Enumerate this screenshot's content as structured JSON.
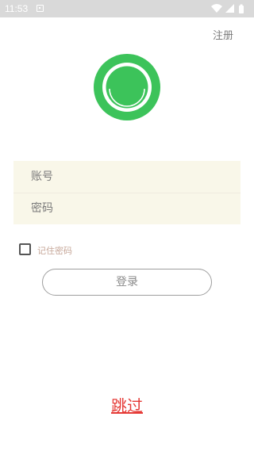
{
  "status_bar": {
    "time": "11:53",
    "icons": [
      "notification-icon",
      "wifi-icon",
      "cell-signal-icon",
      "battery-icon"
    ],
    "background": "#d9d9d9"
  },
  "header": {
    "register_label": "注册"
  },
  "logo": {
    "icon": "app-logo-ring",
    "color": "#3cc35a"
  },
  "form": {
    "account_placeholder": "账号",
    "password_placeholder": "密码",
    "panel_color": "#f9f7e9"
  },
  "remember": {
    "label": "记住密码",
    "checked": false
  },
  "login": {
    "label": "登录"
  },
  "skip": {
    "label": "跳过",
    "color": "#e53935"
  }
}
